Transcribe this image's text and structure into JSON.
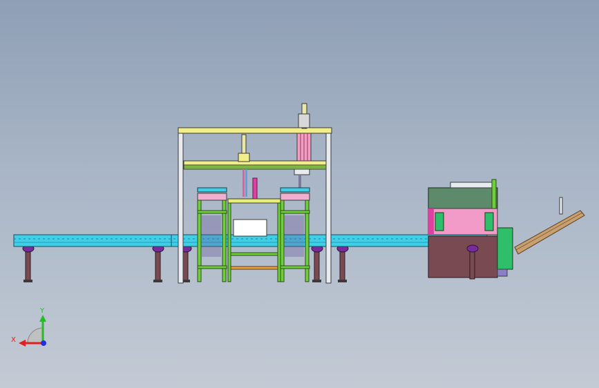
{
  "viewport": {
    "background_top": "#8f9fb5",
    "background_bottom": "#c3cad4"
  },
  "colors": {
    "conveyor": "#3fd0e8",
    "frame_yellow": "#f2ef8a",
    "frame_white": "#e8ecf0",
    "frame_green": "#6ecf3a",
    "leg": "#7a4a52",
    "foot": "#7a2a9a",
    "cabinet": "#7a4a52",
    "panel_pink": "#f29ac8",
    "guard_green": "#5c8a6a",
    "motor_green": "#2fbf6a",
    "chute": "#c8a070",
    "magenta": "#e040a0",
    "axis_x": "#e02020",
    "axis_y": "#20c020",
    "axis_z": "#2030e0"
  },
  "axis_triad": {
    "x_label": "X",
    "y_label": "Y",
    "x_icon": "x-axis-arrow-icon",
    "y_icon": "y-axis-arrow-icon",
    "z_icon": "z-axis-dot-icon"
  }
}
